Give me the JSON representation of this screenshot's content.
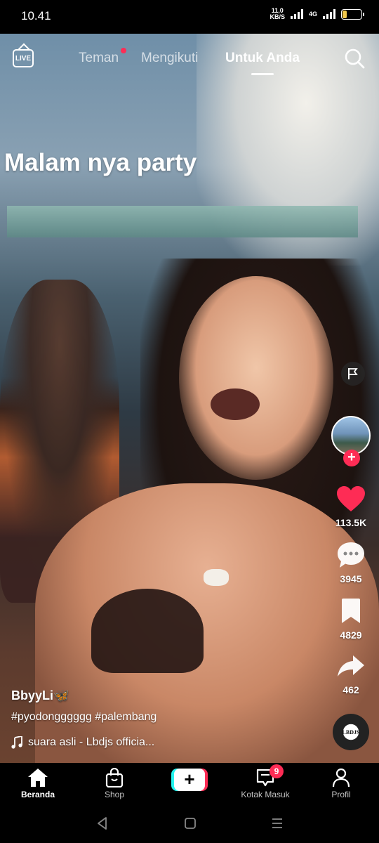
{
  "status_bar": {
    "time": "10.41",
    "net_speed_value": "11,0",
    "net_speed_unit": "KB/S",
    "network_type": "4G",
    "battery_level": "20",
    "battery_fraction": 0.2
  },
  "top_nav": {
    "live_label": "LIVE",
    "tabs": [
      {
        "label": "Teman",
        "has_dot": true
      },
      {
        "label": "Mengikuti"
      },
      {
        "label": "Untuk Anda",
        "active": true
      }
    ]
  },
  "video": {
    "caption": "Malam nya party"
  },
  "actions": {
    "likes": "113.5K",
    "comments": "3945",
    "saves": "4829",
    "shares": "462"
  },
  "post": {
    "username": "BbyyLi🦋",
    "description": "#pyodongggggg #palembang",
    "sound": "suara asli - Lbdjs officia...",
    "disc_label": "LBDJS"
  },
  "bottom_tabs": {
    "home": "Beranda",
    "shop": "Shop",
    "create": "+",
    "inbox": "Kotak Masuk",
    "inbox_badge": "9",
    "profile": "Profil"
  },
  "colors": {
    "accent": "#fe2c55",
    "create_cyan": "#25f4ee"
  },
  "icons": [
    "live-icon",
    "search-icon",
    "flag-icon",
    "heart-icon",
    "comment-icon",
    "bookmark-icon",
    "share-icon",
    "music-note-icon",
    "home-icon",
    "shop-bag-icon",
    "inbox-icon",
    "profile-icon",
    "back-icon",
    "home-square-icon",
    "recents-icon"
  ]
}
